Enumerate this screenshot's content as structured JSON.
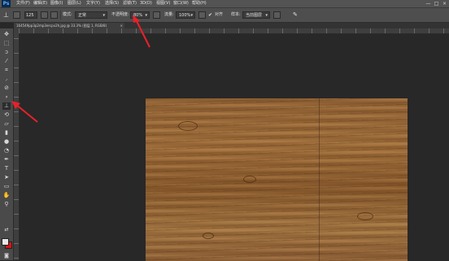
{
  "app": {
    "logo": "Ps"
  },
  "menu": [
    "文件(F)",
    "编辑(E)",
    "图像(I)",
    "图层(L)",
    "文字(Y)",
    "选择(S)",
    "滤镜(T)",
    "3D(D)",
    "视图(V)",
    "窗口(W)",
    "帮助(H)"
  ],
  "window_controls": [
    "—",
    "□",
    "×"
  ],
  "options": {
    "brush_size": "125",
    "mode_label": "模式:",
    "mode_value": "正常",
    "opacity_label": "不透明度:",
    "opacity_value": "80%",
    "flow_label": "流量:",
    "flow_value": "100%",
    "aligned_label": "对齐",
    "sample_label": "样本:",
    "sample_value": "当前图层"
  },
  "document": {
    "tab_title": "164549pp3p2mp3ercpx2h.jpg @ 33.3% (图层 1, RGB/8)",
    "close": "×"
  },
  "tools": [
    "move-tool",
    "marquee-tool",
    "lasso-tool",
    "quick-select-tool",
    "crop-tool",
    "eyedropper-tool",
    "healing-tool",
    "brush-tool",
    "clone-stamp-tool",
    "history-brush-tool",
    "eraser-tool",
    "gradient-tool",
    "blur-tool",
    "dodge-tool",
    "pen-tool",
    "type-tool",
    "path-select-tool",
    "shape-tool",
    "hand-tool",
    "zoom-tool"
  ],
  "colors": {
    "foreground": "#e8e8e8",
    "background": "#d4141c",
    "annotation": "#e8212a"
  }
}
